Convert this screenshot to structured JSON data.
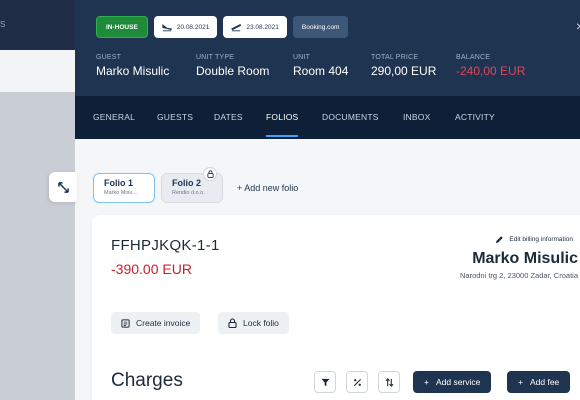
{
  "backdrop": {
    "label": "S"
  },
  "header": {
    "status": "IN-HOUSE",
    "arrival": "20.08.2021",
    "departure": "23.08.2021",
    "source": "Booking.com",
    "close": "×"
  },
  "info": [
    {
      "label": "GUEST",
      "value": "Marko Misulic",
      "negative": false
    },
    {
      "label": "UNIT TYPE",
      "value": "Double Room",
      "negative": false
    },
    {
      "label": "UNIT",
      "value": "Room 404",
      "negative": false
    },
    {
      "label": "TOTAL PRICE",
      "value": "290,00 EUR",
      "negative": false
    },
    {
      "label": "BALANCE",
      "value": "-240,00 EUR",
      "negative": true
    }
  ],
  "tabs": [
    "GENERAL",
    "GUESTS",
    "DATES",
    "FOLIOS",
    "DOCUMENTS",
    "INBOX",
    "ACTIVITY"
  ],
  "active_tab": "FOLIOS",
  "folios": [
    {
      "title": "Folio 1",
      "subtitle": "Marko Misu...",
      "active": true,
      "locked": false
    },
    {
      "title": "Folio 2",
      "subtitle": "Rendio d.o.o.",
      "active": false,
      "locked": true
    }
  ],
  "add_folio": "Add new folio",
  "folio_card": {
    "number": "FFHPJKQK-1-1",
    "balance": "-390.00 EUR",
    "edit_billing": "Edit billing information",
    "customer_name": "Marko Misulic",
    "customer_address": "Narodni trg 2, 23000 Zadar, Croatia",
    "create_invoice": "Create invoice",
    "lock_folio": "Lock folio",
    "charges_title": "Charges",
    "add_service": "Add service",
    "add_fee": "Add fee"
  },
  "colors": {
    "header_bg": "#1f3450",
    "tabs_bg": "#0d2037",
    "status_green": "#1f8a3a",
    "negative_red": "#c8202e",
    "accent_blue": "#3ea2ff"
  }
}
